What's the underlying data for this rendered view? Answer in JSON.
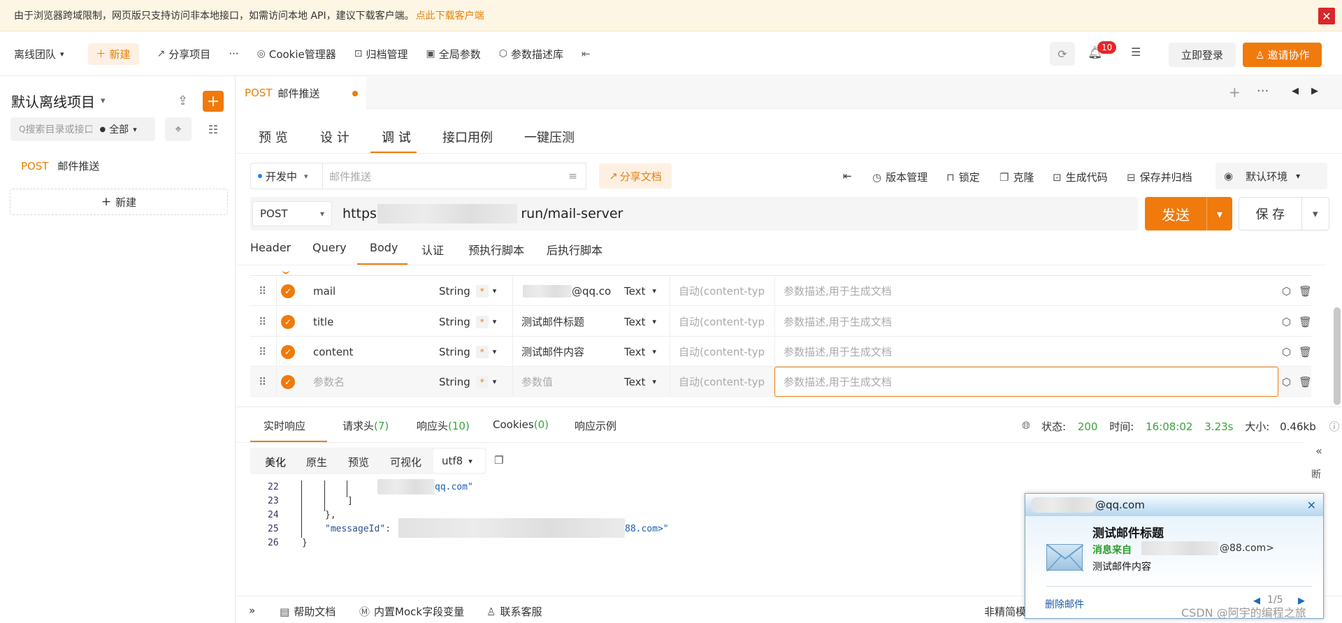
{
  "notice": {
    "text": "由于浏览器跨域限制，网页版只支持访问非本地接口，如需访问本地 API，建议下载客户端。",
    "link": "点此下载客户端",
    "close": "✕"
  },
  "topbar": {
    "team": "离线团队",
    "new": "新建",
    "share": "分享项目",
    "more": "···",
    "cookie": "Cookie管理器",
    "archive": "归档管理",
    "global": "全局参数",
    "param_desc": "参数描述库",
    "notif_count": "10",
    "login": "立即登录",
    "invite": "邀请协作"
  },
  "sidebar": {
    "project": "默认离线项目",
    "search_placeholder": "搜索目录或接口",
    "filter": "全部",
    "api_method": "POST",
    "api_name": "邮件推送",
    "new": "新建"
  },
  "tab": {
    "method": "POST",
    "name": "邮件推送"
  },
  "subtabs": [
    "预 览",
    "设 计",
    "调 试",
    "接口用例",
    "一键压测"
  ],
  "toolbar": {
    "status": "开发中",
    "name_placeholder": "邮件推送",
    "share_doc": "分享文档",
    "version": "版本管理",
    "lock": "锁定",
    "clone": "克隆",
    "gen_code": "生成代码",
    "save_archive": "保存并归档",
    "env": "默认环境"
  },
  "request": {
    "method": "POST",
    "url_prefix": "https:",
    "url_suffix": "run/mail-server",
    "send": "发送",
    "save": "保 存"
  },
  "param_tabs": [
    "Header",
    "Query",
    "Body",
    "认证",
    "预执行脚本",
    "后执行脚本"
  ],
  "params": [
    {
      "name": "mail",
      "type": "String",
      "value": "@qq.co",
      "vtype": "Text",
      "ctype": "自动(content-typ",
      "desc": "参数描述,用于生成文档"
    },
    {
      "name": "title",
      "type": "String",
      "value": "测试邮件标题",
      "vtype": "Text",
      "ctype": "自动(content-typ",
      "desc": "参数描述,用于生成文档"
    },
    {
      "name": "content",
      "type": "String",
      "value": "测试邮件内容",
      "vtype": "Text",
      "ctype": "自动(content-typ",
      "desc": "参数描述,用于生成文档"
    },
    {
      "name": "参数名",
      "type": "String",
      "value": "参数值",
      "vtype": "Text",
      "ctype": "自动(content-typ",
      "desc": "参数描述,用于生成文档"
    }
  ],
  "response": {
    "tabs": {
      "live": "实时响应",
      "req_headers": "请求头",
      "req_headers_n": "(7)",
      "resp_headers": "响应头",
      "resp_headers_n": "(10)",
      "cookies": "Cookies",
      "cookies_n": "(0)",
      "example": "响应示例"
    },
    "status_label": "状态:",
    "status": "200",
    "time_label": "时间:",
    "time": "16:08:02",
    "duration": "3.23s",
    "size_label": "大小:",
    "size": "0.46kb",
    "formats": [
      "美化",
      "原生",
      "预览",
      "可视化"
    ],
    "encoding": "utf8",
    "code": {
      "l22": "22",
      "l22_text": "qq.com\"",
      "l23": "23",
      "l23_text": "]",
      "l24": "24",
      "l24_text": "},",
      "l25": "25",
      "l25_key": "\"messageId\":",
      "l25_text": "88.com>\"",
      "l26": "26",
      "l26_text": "}"
    },
    "side": "断"
  },
  "footer": {
    "help": "帮助文档",
    "mock": "内置Mock字段变量",
    "support": "联系客服",
    "right": "非精简模"
  },
  "popup": {
    "from_email": "@qq.com",
    "subject": "测试邮件标题",
    "from_label": "消息来自",
    "from_addr": "@88.com>",
    "content": "测试邮件内容",
    "delete": "删除邮件",
    "page": "1/5"
  },
  "watermark": "CSDN @阿宇的编程之旅"
}
